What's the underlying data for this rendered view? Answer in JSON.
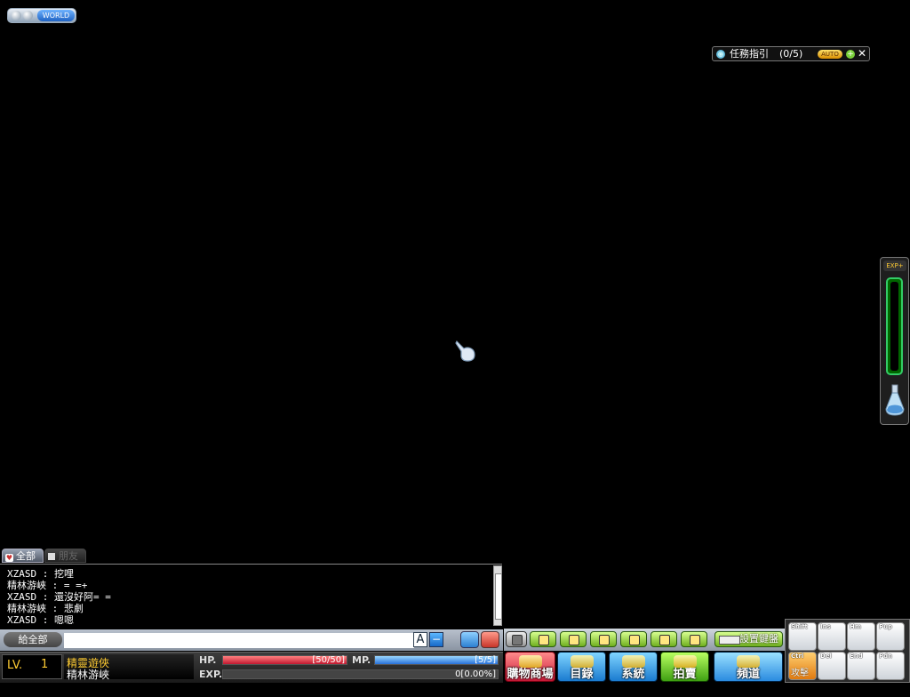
{
  "top_left": {
    "world_label": "WORLD"
  },
  "quest_helper": {
    "title": "任務指引",
    "count": "(0/5)",
    "auto_label": "AUTO",
    "plus": "+",
    "close": "✕"
  },
  "exp_panel": {
    "label": "EXP+"
  },
  "chat": {
    "tabs": [
      {
        "label": "全部"
      },
      {
        "label": "朋友"
      }
    ],
    "messages": [
      "XZASD : 挖哩",
      "精林游峽 : = =+",
      "XZASD : 還沒好阿= =",
      "精林游峽 : 悲劇",
      "XZASD : 嗯嗯"
    ],
    "target_label": "給全部",
    "input_value": "",
    "font_button": "A",
    "minimize_button": "−"
  },
  "status": {
    "lv_label": "LV.",
    "level": "1",
    "job": "精靈遊俠",
    "name": "精林游峽",
    "hp_label": "HP.",
    "hp_text": "[50/50]",
    "hp_fraction": 1.0,
    "mp_label": "MP.",
    "mp_text": "[5/5]",
    "mp_fraction": 1.0,
    "exp_label": "EXP.",
    "exp_text": "0[0.00%]",
    "exp_fraction": 0.0
  },
  "quick_menu": {
    "icons": [
      "character-icon",
      "stats-icon",
      "skills-icon",
      "quest-icon",
      "inventory-icon",
      "equipment-icon",
      "notes-icon"
    ],
    "key_setting_label": "設置鍵盤"
  },
  "main_buttons": {
    "cash_shop": "購物商場",
    "menu": "目錄",
    "system": "系統",
    "auction": "拍賣",
    "channel": "頻道"
  },
  "hotkeys": [
    {
      "key": "Shift",
      "label": ""
    },
    {
      "key": "Ins",
      "label": ""
    },
    {
      "key": "Hm",
      "label": ""
    },
    {
      "key": "Pup",
      "label": ""
    },
    {
      "key": "Ctrl",
      "label": "攻擊"
    },
    {
      "key": "Del",
      "label": ""
    },
    {
      "key": "End",
      "label": ""
    },
    {
      "key": "Pdn",
      "label": ""
    }
  ]
}
